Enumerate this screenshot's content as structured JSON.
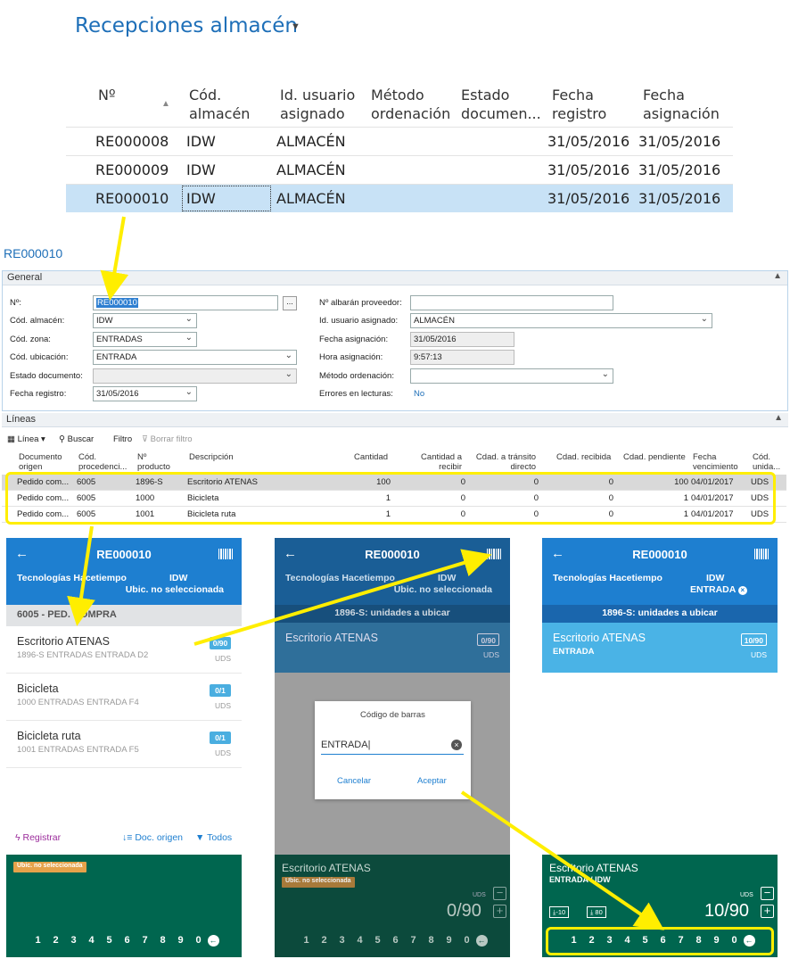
{
  "list": {
    "title": "Recepciones almacén",
    "headers": [
      "Nº",
      "Cód.\nalmacén",
      "Id. usuario\nasignado",
      "Método\nordenación",
      "Estado\ndocumen...",
      "Fecha\nregistro",
      "Fecha\nasignación"
    ],
    "rows": [
      {
        "no": "RE000008",
        "almacen": "IDW",
        "usuario": "ALMACÉN",
        "metodo": "",
        "estado": "",
        "fecha_registro": "31/05/2016",
        "fecha_asignacion": "31/05/2016"
      },
      {
        "no": "RE000009",
        "almacen": "IDW",
        "usuario": "ALMACÉN",
        "metodo": "",
        "estado": "",
        "fecha_registro": "31/05/2016",
        "fecha_asignacion": "31/05/2016"
      },
      {
        "no": "RE000010",
        "almacen": "IDW",
        "usuario": "ALMACÉN",
        "metodo": "",
        "estado": "",
        "fecha_registro": "31/05/2016",
        "fecha_asignacion": "31/05/2016"
      }
    ]
  },
  "card": {
    "doc_link": "RE000010",
    "general_label": "General",
    "fields_left": [
      {
        "label": "Nº:",
        "value": "RE000010"
      },
      {
        "label": "Cód. almacén:",
        "value": "IDW"
      },
      {
        "label": "Cód. zona:",
        "value": "ENTRADAS"
      },
      {
        "label": "Cód. ubicación:",
        "value": "ENTRADA"
      },
      {
        "label": "Estado documento:",
        "value": ""
      },
      {
        "label": "Fecha registro:",
        "value": "31/05/2016"
      }
    ],
    "fields_right": [
      {
        "label": "Nº albarán proveedor:",
        "value": ""
      },
      {
        "label": "Id. usuario asignado:",
        "value": "ALMACÉN"
      },
      {
        "label": "Fecha asignación:",
        "value": "31/05/2016"
      },
      {
        "label": "Hora asignación:",
        "value": "9:57:13"
      },
      {
        "label": "Método ordenación:",
        "value": ""
      },
      {
        "label": "Errores en lecturas:",
        "value": "No"
      }
    ],
    "dots_label": "..."
  },
  "lines": {
    "section_label": "Líneas",
    "toolbar": {
      "linea": "Línea",
      "buscar": "Buscar",
      "filtro": "Filtro",
      "borrar_filtro": "Borrar filtro"
    },
    "headers": [
      "Documento\norigen",
      "Cód.\nprocedenci...",
      "Nº\nproducto",
      "Descripción",
      "Cantidad",
      "Cantidad a\nrecibir",
      "Cdad. a tránsito\ndirecto",
      "Cdad. recibida",
      "Cdad. pendiente",
      "Fecha\nvencimiento",
      "Cód.\nunida..."
    ],
    "rows": [
      [
        "Pedido com...",
        "6005",
        "1896-S",
        "Escritorio ATENAS",
        "100",
        "0",
        "0",
        "0",
        "100",
        "04/01/2017",
        "UDS"
      ],
      [
        "Pedido com...",
        "6005",
        "1000",
        "Bicicleta",
        "1",
        "0",
        "0",
        "0",
        "1",
        "04/01/2017",
        "UDS"
      ],
      [
        "Pedido com...",
        "6005",
        "1001",
        "Bicicleta ruta",
        "1",
        "0",
        "0",
        "0",
        "1",
        "04/01/2017",
        "UDS"
      ]
    ]
  },
  "phone1": {
    "title": "RE000010",
    "company": "Tecnologías Hacetiempo",
    "almacen": "IDW",
    "ubicacion": "Ubic. no seleccionada",
    "group": "6005 - PED. COMPRA",
    "items": [
      {
        "name": "Escritorio ATENAS",
        "sub": "1896-S ENTRADAS ENTRADA D2",
        "badge": "0/90",
        "unit": "UDS"
      },
      {
        "name": "Bicicleta",
        "sub": "1000 ENTRADAS ENTRADA F4",
        "badge": "0/1",
        "unit": "UDS"
      },
      {
        "name": "Bicicleta ruta",
        "sub": "1001 ENTRADAS ENTRADA F5",
        "badge": "0/1",
        "unit": "UDS"
      }
    ],
    "actions": {
      "registrar": "Registrar",
      "doc_origen": "Doc. origen",
      "todos": "Todos"
    },
    "chip": "Ubic. no seleccionada",
    "keys": [
      "1",
      "2",
      "3",
      "4",
      "5",
      "6",
      "7",
      "8",
      "9",
      "0"
    ]
  },
  "phone2": {
    "title": "RE000010",
    "company": "Tecnologías Hacetiempo",
    "almacen": "IDW",
    "ubicacion": "Ubic. no seleccionada",
    "band": "1896-S: unidades a ubicar",
    "item_name": "Escritorio ATENAS",
    "badge": "0/90",
    "unit": "UDS",
    "dialog": {
      "title": "Código de barras",
      "value": "ENTRADA",
      "cancel": "Cancelar",
      "accept": "Aceptar"
    },
    "bottom_name": "Escritorio ATENAS",
    "chip": "Ubic. no seleccionada",
    "uds_label": "UDS",
    "qty": "0/90",
    "keys": [
      "1",
      "2",
      "3",
      "4",
      "5",
      "6",
      "7",
      "8",
      "9",
      "0"
    ]
  },
  "phone3": {
    "title": "RE000010",
    "company": "Tecnologías Hacetiempo",
    "almacen": "IDW",
    "zona": "ENTRADA",
    "band": "1896-S: unidades a ubicar",
    "item_name": "Escritorio ATENAS",
    "item_sub": "ENTRADA",
    "badge": "10/90",
    "unit": "UDS",
    "bottom_name": "Escritorio ATENAS",
    "bottom_sub": "ENTRADA / IDW",
    "btn_minus10": "-10",
    "btn_80": "80",
    "uds_label": "UDS",
    "qty": "10/90",
    "keys": [
      "1",
      "2",
      "3",
      "4",
      "5",
      "6",
      "7",
      "8",
      "9",
      "0"
    ]
  },
  "colors": {
    "accent": "#1e7fd0",
    "green": "#00664f",
    "highlight": "#ffee00",
    "chip": "#e5a24a"
  }
}
